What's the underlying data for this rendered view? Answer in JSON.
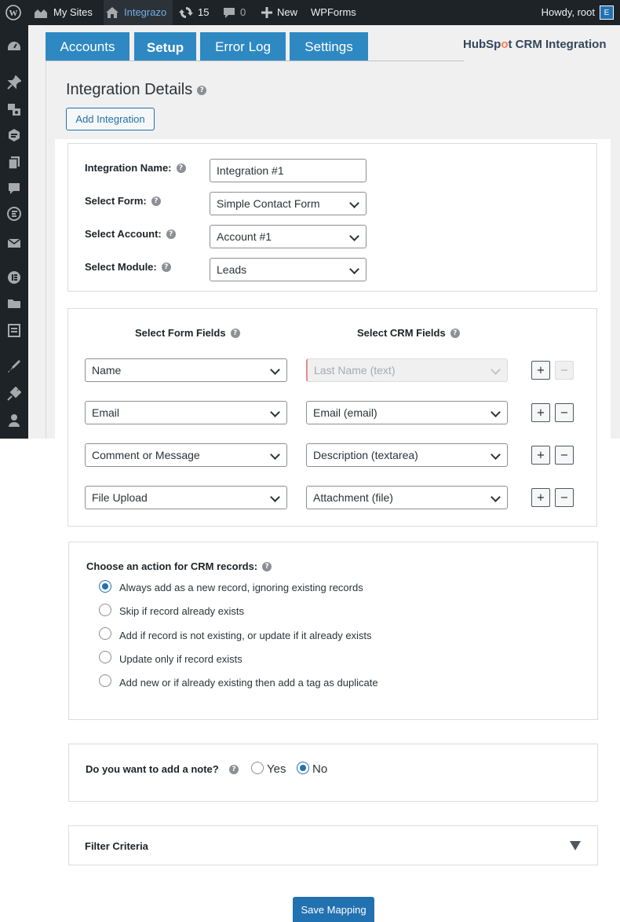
{
  "adminbar": {
    "my_sites": "My Sites",
    "site_name": "Integrazo",
    "updates_count": "15",
    "comments_count": "0",
    "new_label": "New",
    "wpforms_label": "WPForms",
    "howdy": "Howdy, root",
    "avatar_letter": "E"
  },
  "tabs": [
    {
      "label": "Accounts",
      "active": false
    },
    {
      "label": "Setup",
      "active": true
    },
    {
      "label": "Error Log",
      "active": false
    },
    {
      "label": "Settings",
      "active": false
    }
  ],
  "brand": {
    "hub": "HubSp",
    "spot_o": "o",
    "t": "t",
    "rest": " CRM Integration",
    "color": "#ff7a59"
  },
  "page": {
    "title": "Integration Details",
    "add_button": "Add Integration",
    "help_glyph": "?"
  },
  "details": {
    "integration_name_label": "Integration Name:",
    "integration_name_value": "Integration #1",
    "form_label": "Select Form:",
    "form_value": "Simple Contact Form",
    "account_label": "Select Account:",
    "account_value": "Account #1",
    "module_label": "Select Module:",
    "module_value": "Leads"
  },
  "mapping": {
    "form_fields_head": "Select Form Fields",
    "crm_fields_head": "Select CRM Fields",
    "rows": [
      {
        "form_field": "Name",
        "crm_field": "Last Name (text)",
        "locked": true
      },
      {
        "form_field": "Email",
        "crm_field": "Email (email)",
        "locked": false
      },
      {
        "form_field": "Comment or Message",
        "crm_field": "Description (textarea)",
        "locked": false
      },
      {
        "form_field": "File Upload",
        "crm_field": "Attachment (file)",
        "locked": false
      }
    ],
    "plus_glyph": "+",
    "minus_glyph": "−"
  },
  "action": {
    "heading": "Choose an action for CRM records:",
    "options": [
      {
        "label": "Always add as a new record, ignoring existing records",
        "checked": true
      },
      {
        "label": "Skip if record already exists",
        "checked": false
      },
      {
        "label": "Add if record is not existing, or update if it already exists",
        "checked": false
      },
      {
        "label": "Update only if record exists",
        "checked": false
      },
      {
        "label": "Add new or if already existing then add a tag as duplicate",
        "checked": false
      }
    ]
  },
  "note": {
    "question": "Do you want to add a note?",
    "yes": "Yes",
    "no": "No",
    "selected": "No"
  },
  "filter": {
    "label": "Filter Criteria"
  },
  "save": {
    "label": "Save Mapping"
  },
  "colors": {
    "accent": "#2271b1",
    "tab": "#2e89c2",
    "adminbar": "#1d2327"
  }
}
